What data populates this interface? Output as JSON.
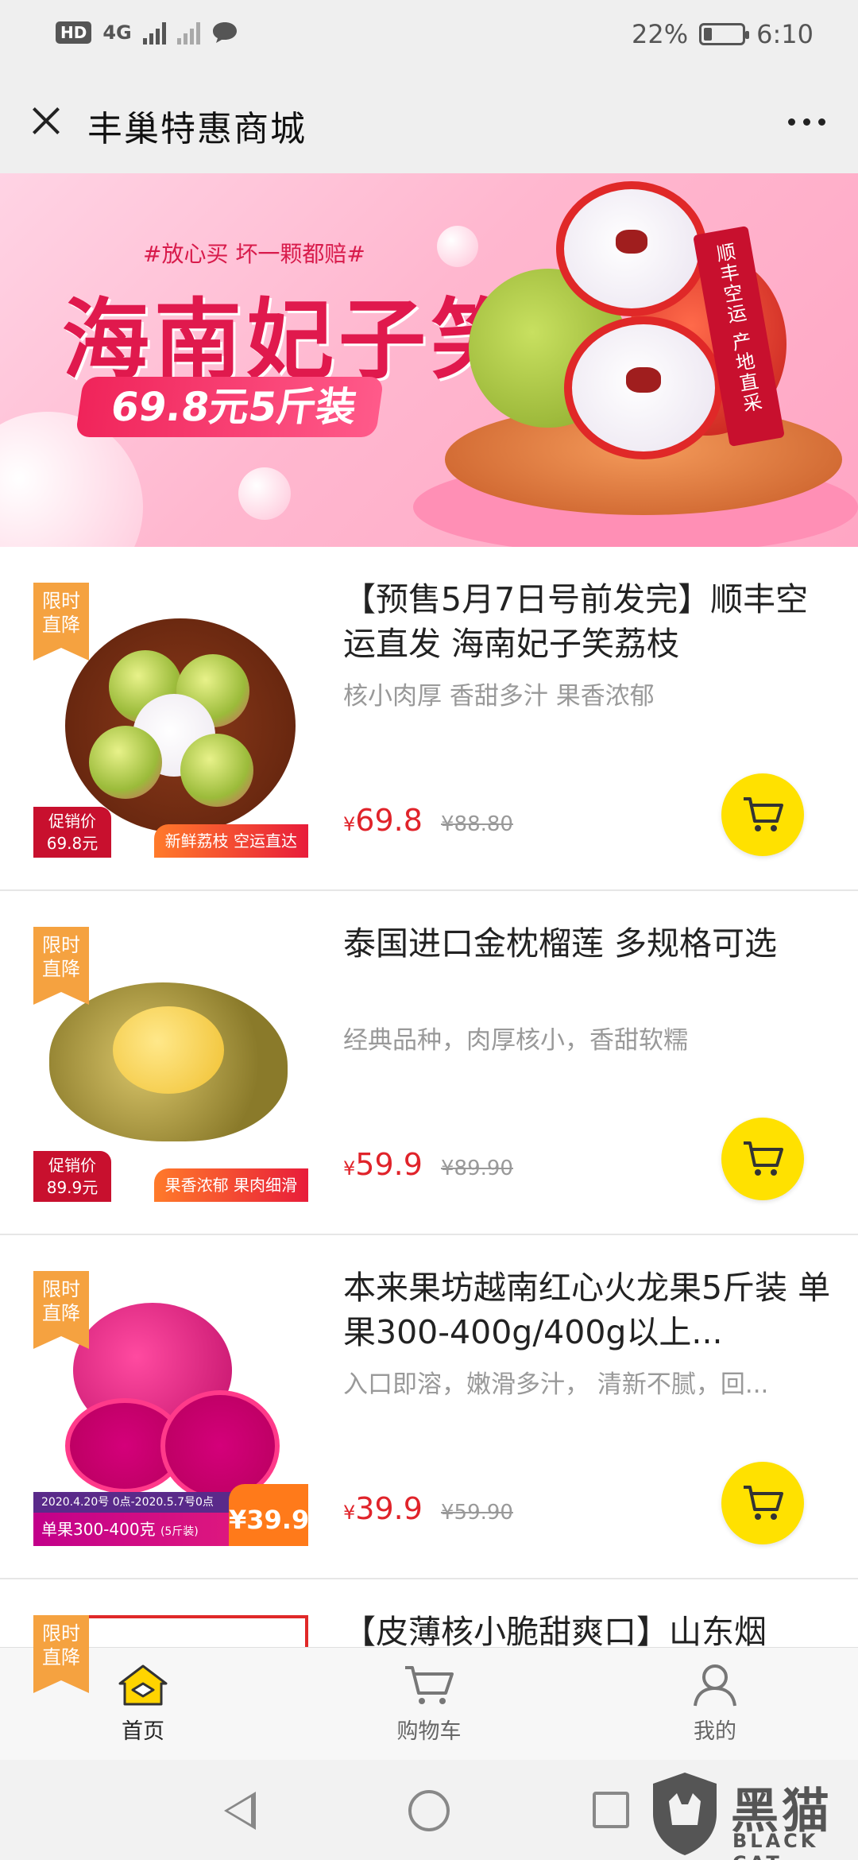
{
  "status_bar": {
    "hd": "HD",
    "network": "4G",
    "battery_text": "22%",
    "battery_level": 0.22,
    "time": "6:10"
  },
  "header": {
    "title": "丰巢特惠商城"
  },
  "banner": {
    "tagline": "#放心买 坏一颗都赔#",
    "headline": "海南妃子笑",
    "price_pill": "69.8元5斤装",
    "ribbon": "顺丰空运 产地直采"
  },
  "products": [
    {
      "flag": "限时直降",
      "promo_label": "促销价",
      "promo_price": "69.8元",
      "strip": "新鲜荔枝 空运直达",
      "title": "【预售5月7日号前发完】顺丰空运直发 海南妃子笑荔枝",
      "subtitle": "核小肉厚 香甜多汁 果香浓郁",
      "currency": "¥",
      "price": "69.8",
      "original_price": "¥88.80"
    },
    {
      "flag": "限时直降",
      "promo_label": "促销价",
      "promo_price": "89.9元",
      "strip": "果香浓郁 果肉细滑",
      "title": "泰国进口金枕榴莲 多规格可选",
      "subtitle": "经典品种，肉厚核小，香甜软糯",
      "currency": "¥",
      "price": "59.9",
      "original_price": "¥89.90"
    },
    {
      "flag": "限时直降",
      "date_range": "2020.4.20号 0点-2020.5.7号0点",
      "bar_text": "单果300-400克",
      "bar_note": "(5斤装)",
      "img_price": "¥39.9",
      "title": "本来果坊越南红心火龙果5斤装 单果300-400g/400g以上...",
      "subtitle": "入口即溶，嫩滑多汁， 清新不腻，回...",
      "currency": "¥",
      "price": "39.9",
      "original_price": "¥59.90"
    },
    {
      "flag": "限时直降",
      "title": "【皮薄核小脆甜爽口】山东烟"
    }
  ],
  "bottom_nav": [
    {
      "label": "首页",
      "icon": "home-icon"
    },
    {
      "label": "购物车",
      "icon": "cart-icon"
    },
    {
      "label": "我的",
      "icon": "profile-icon"
    }
  ],
  "watermark": {
    "cn": "黑猫",
    "en": "BLACK CAT"
  },
  "colors": {
    "accent_yellow": "#ffe100",
    "price_red": "#e0232a",
    "flag_orange": "#f5a240",
    "promo_red": "#c8102e"
  }
}
